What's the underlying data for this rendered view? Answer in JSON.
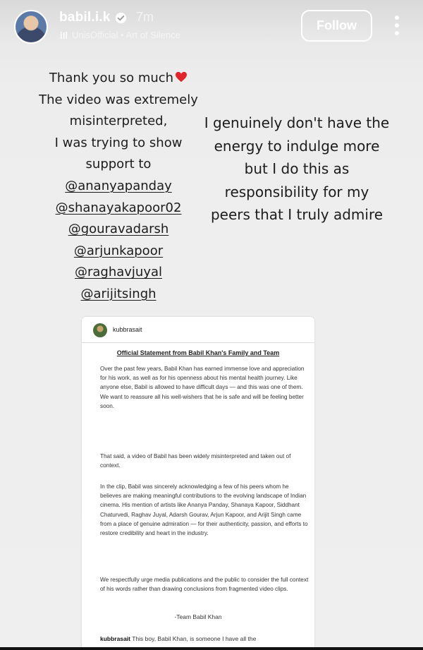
{
  "header": {
    "username": "babil.i.k",
    "timestamp": "7m",
    "music": "UnisOfficial • Art of Silence",
    "follow_label": "Follow"
  },
  "story_text": {
    "left_lines": [
      "Thank you so much",
      "The video was extremely",
      "misinterpreted,",
      "I was trying to show",
      "support to"
    ],
    "mentions": [
      "@ananyapanday",
      "@shanayakapoor02",
      "@gouravadarsh",
      "@arjunkapoor",
      "@raghavjuyal",
      "@arijitsingh"
    ],
    "right_lines": [
      "I genuinely don't have the",
      "energy to indulge more",
      "but I do this as",
      "responsibility for my",
      "peers that I truly admire"
    ]
  },
  "shared_post": {
    "username": "kubbrasait",
    "title": "Official Statement from Babil Khan's Family and Team",
    "paragraphs": [
      "Over the past few years, Babil Khan has earned immense love and appreciation for his work, as well as for his openness about his mental health journey. Like anyone else, Babil is allowed to have difficult days — and this was one of them. We want to reassure all his well-wishers that he is safe and will be feeling better soon.",
      "That said, a video of Babil has been widely misinterpreted and taken out of context.",
      "In the clip, Babil was sincerely acknowledging a few of his peers whom he believes are making meaningful contributions to the evolving landscape of Indian cinema. His mention of artists like Ananya Panday, Shanaya Kapoor, Siddhant Chaturvedi, Raghav Juyal, Adarsh Gourav, Arjun Kapoor, and Arijit Singh came from a place of genuine admiration — for their authenticity, passion, and efforts to restore credibility and heart in the industry.",
      "We respectfully urge media publications and the public to consider the full context of his words rather than drawing conclusions from fragmented video clips."
    ],
    "signature": "-Team Babil Khan",
    "caption_user": "kubbrasait",
    "caption_text": "This boy, Babil Khan, is someone I have all the"
  },
  "colors": {
    "story_background": "#ececec",
    "text": "#1c1c1c",
    "heart": "#e0262c",
    "header_text": "#ffffff"
  },
  "icons": [
    "verified-badge-icon",
    "music-note-icon",
    "more-options-icon",
    "red-heart-icon"
  ]
}
